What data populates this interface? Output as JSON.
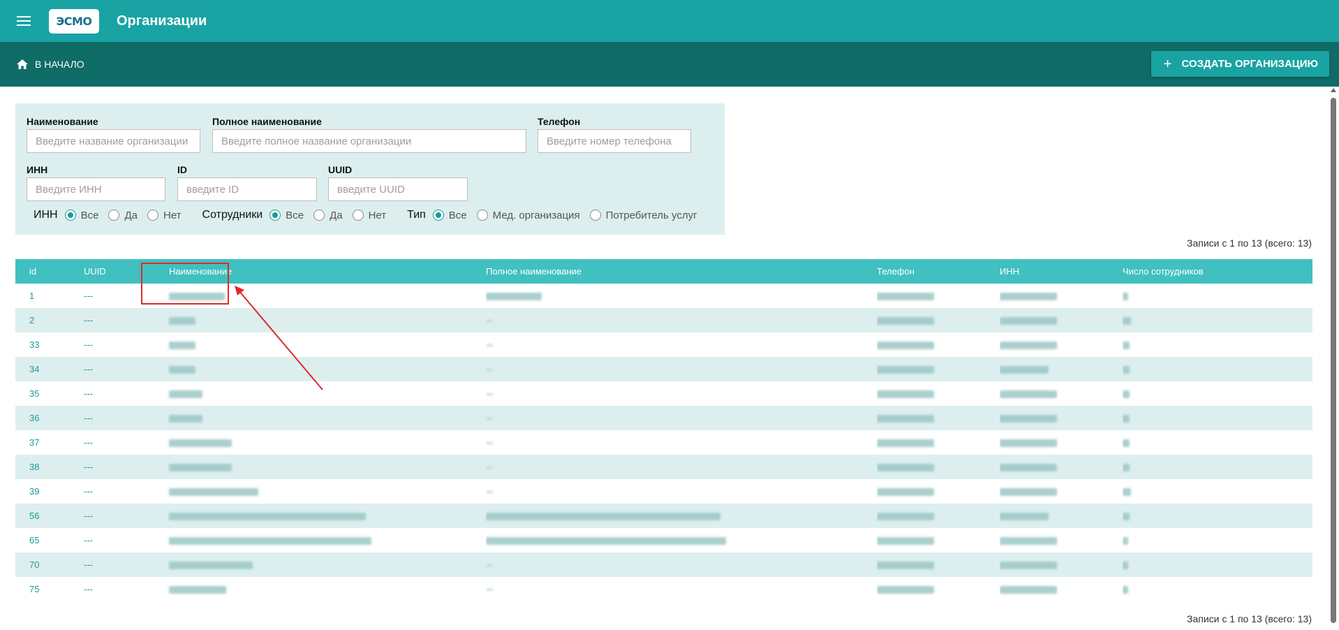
{
  "app": {
    "title": "Организации",
    "logo_text": "ЭСМО"
  },
  "nav": {
    "home_label": "В НАЧАЛО",
    "create_label": "СОЗДАТЬ ОРГАНИЗАЦИЮ"
  },
  "filters": {
    "name": {
      "label": "Наименование",
      "placeholder": "Введите название организации",
      "value": ""
    },
    "full_name": {
      "label": "Полное наименование",
      "placeholder": "Введите полное название организации",
      "value": ""
    },
    "phone": {
      "label": "Телефон",
      "placeholder": "Введите номер телефона",
      "value": ""
    },
    "inn": {
      "label": "ИНН",
      "placeholder": "Введите ИНН",
      "value": ""
    },
    "id": {
      "label": "ID",
      "placeholder": "введите ID",
      "value": ""
    },
    "uuid": {
      "label": "UUID",
      "placeholder": "введите UUID",
      "value": ""
    },
    "radio_groups": [
      {
        "label": "ИНН",
        "options": [
          "Все",
          "Да",
          "Нет"
        ],
        "selected": "Все"
      },
      {
        "label": "Сотрудники",
        "options": [
          "Все",
          "Да",
          "Нет"
        ],
        "selected": "Все"
      },
      {
        "label": "Тип",
        "options": [
          "Все",
          "Мед. организация",
          "Потребитель услуг"
        ],
        "selected": "Все"
      }
    ]
  },
  "records_info": "Записи с 1 по 13 (всего: 13)",
  "table": {
    "columns": [
      "id",
      "UUID",
      "Наименование",
      "Полное наименование",
      "Телефон",
      "ИНН",
      "Число сотрудников"
    ],
    "rows": [
      {
        "id": "1",
        "uuid": "---"
      },
      {
        "id": "2",
        "uuid": "---"
      },
      {
        "id": "33",
        "uuid": "---"
      },
      {
        "id": "34",
        "uuid": "---"
      },
      {
        "id": "35",
        "uuid": "---"
      },
      {
        "id": "36",
        "uuid": "---"
      },
      {
        "id": "37",
        "uuid": "---"
      },
      {
        "id": "38",
        "uuid": "---"
      },
      {
        "id": "39",
        "uuid": "---"
      },
      {
        "id": "56",
        "uuid": "---"
      },
      {
        "id": "65",
        "uuid": "---"
      },
      {
        "id": "70",
        "uuid": "---"
      },
      {
        "id": "75",
        "uuid": "---"
      }
    ]
  },
  "colors": {
    "primary": "#1aa3a3",
    "dark": "#0f6b66",
    "header": "#40c0c0",
    "row_alt": "#dcefee",
    "annotation": "#e02a2a"
  }
}
